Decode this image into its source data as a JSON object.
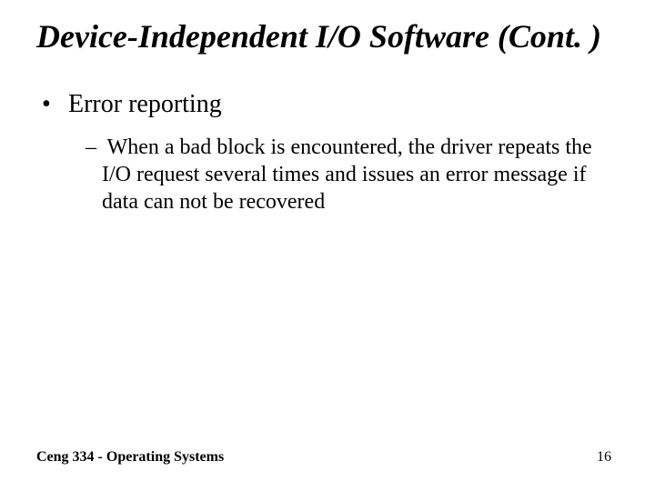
{
  "title": "Device-Independent I/O Software (Cont. )",
  "bullets": [
    {
      "text": "Error reporting",
      "subs": [
        "When a bad block is encountered, the driver repeats the I/O request several times and issues an error message if data can not be recovered"
      ]
    }
  ],
  "footer": {
    "left": "Ceng 334 - Operating Systems",
    "pageNumber": "16"
  }
}
